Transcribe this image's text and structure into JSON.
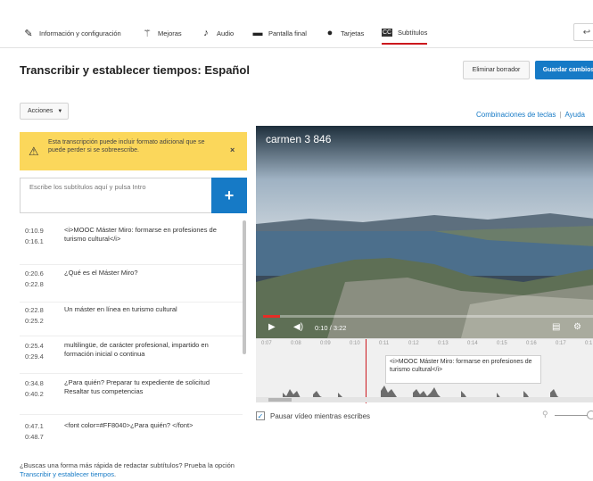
{
  "tabs": [
    {
      "label": "Información y configuración",
      "icon": "pencil-icon"
    },
    {
      "label": "Mejoras",
      "icon": "magic-wand-icon"
    },
    {
      "label": "Audio",
      "icon": "music-note-icon"
    },
    {
      "label": "Pantalla final",
      "icon": "end-screen-icon"
    },
    {
      "label": "Tarjetas",
      "icon": "info-icon"
    },
    {
      "label": "Subtítulos",
      "icon": "cc-icon"
    }
  ],
  "back_symbol": "↩",
  "title": "Transcribir y establecer tiempos: Español",
  "buttons": {
    "discard": "Eliminar borrador",
    "save": "Guardar cambios"
  },
  "actions_label": "Acciones",
  "links": {
    "shortcuts": "Combinaciones de teclas",
    "separator": "|",
    "help": "Ayuda"
  },
  "warning": {
    "text": "Esta transcripción puede incluir formato adicional que se puede perder si se sobreescribe.",
    "close": "×"
  },
  "input_placeholder": "Escribe los subtítulos aquí y pulsa Intro",
  "add_symbol": "+",
  "subtitles": [
    {
      "start": "0:10.9",
      "end": "0:16.1",
      "text": "<i>MOOC Máster Miro: formarse en profesiones de turismo cultural</i>"
    },
    {
      "start": "0:20.6",
      "end": "0:22.8",
      "text": "¿Qué es el Máster Miro?"
    },
    {
      "start": "0:22.8",
      "end": "0:25.2",
      "text": "Un máster en línea en turismo cultural"
    },
    {
      "start": "0:25.4",
      "end": "0:29.4",
      "text": "multilingüe, de carácter profesional, impartido en formación inicial o continua"
    },
    {
      "start": "0:34.8",
      "end": "0:40.2",
      "text": "¿Para quién? Preparar tu expediente de solicitud Resaltar tus competencias"
    },
    {
      "start": "0:47.1",
      "end": "0:48.7",
      "text": "<font color=#FF8040>¿Para quién? </font>"
    }
  ],
  "footer": {
    "text": "¿Buscas una forma más rápida de redactar subtítulos? Prueba la opción ",
    "link": "Transcribir y establecer tiempos",
    "end": "."
  },
  "video": {
    "title": "carmen 3 846",
    "time": "0:10 / 3:22",
    "progress": 0.05
  },
  "timeline": {
    "ticks": [
      "0:07",
      "0:08",
      "0:09",
      "0:10",
      "0:11",
      "0:12",
      "0:13",
      "0:14",
      "0:15",
      "0:16",
      "0:17",
      "0:1"
    ],
    "cue_text": "<i>MOOC Máster Miro: formarse en profesiones de turismo cultural</i>"
  },
  "pause_label": "Pausar vídeo mientras escribes",
  "colors": {
    "accent": "#167ac6",
    "red": "#cc181e",
    "warning": "#fbd75b"
  }
}
